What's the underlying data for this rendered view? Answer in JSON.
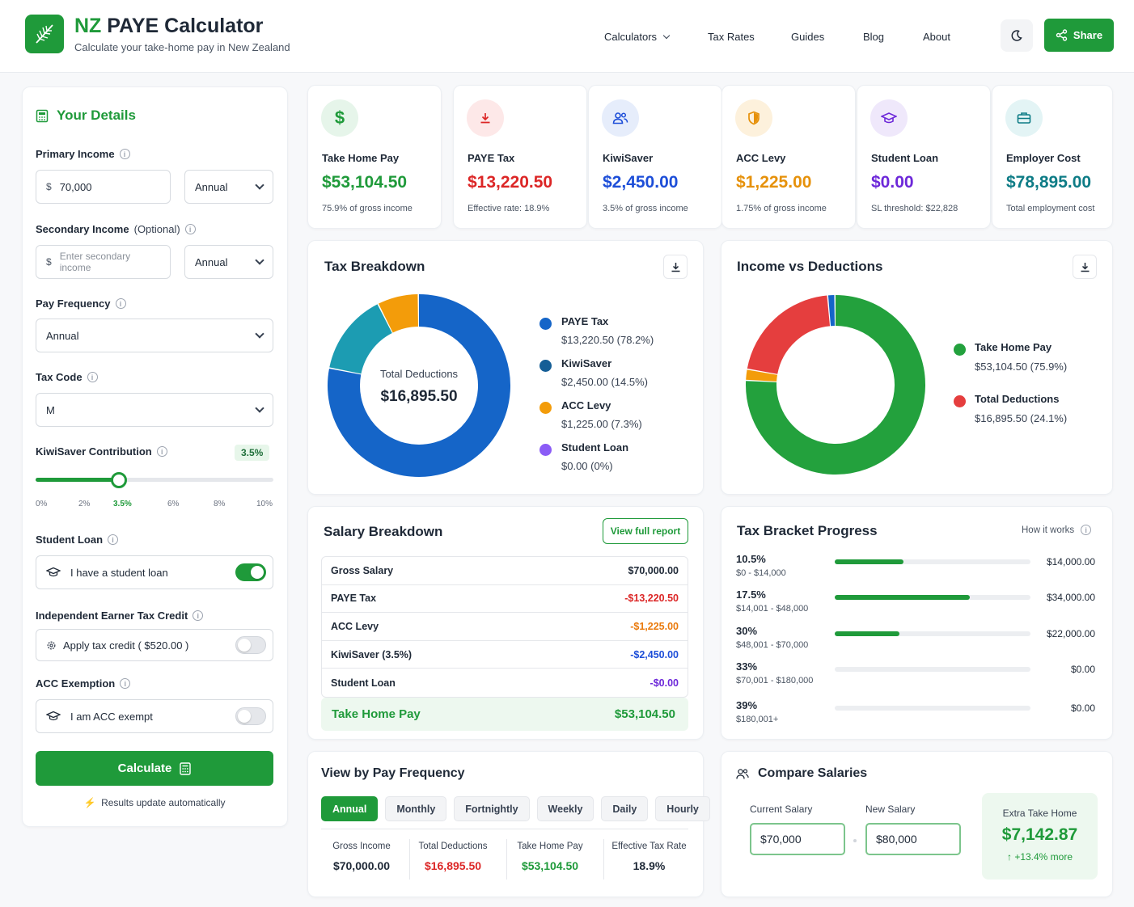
{
  "header": {
    "title_prefix": "NZ",
    "title_rest": "PAYE Calculator",
    "subtitle": "Calculate your take-home pay in New Zealand",
    "nav": [
      "Calculators",
      "Tax Rates",
      "Guides",
      "Blog",
      "About"
    ],
    "share": "Share"
  },
  "sidebar": {
    "title": "Your Details",
    "primary_label": "Primary Income",
    "primary_value": "70,000",
    "primary_period": "Annual",
    "secondary_label": "Secondary Income",
    "secondary_optional": "(Optional)",
    "secondary_placeholder": "Enter secondary income",
    "secondary_period": "Annual",
    "freq_label": "Pay Frequency",
    "freq_value": "Annual",
    "taxcode_label": "Tax Code",
    "taxcode_value": "M",
    "kiwisaver_label": "KiwiSaver Contribution",
    "kiwisaver_value": "3.5%",
    "kiwisaver_fraction": 0.35,
    "ticks": [
      "0%",
      "2%",
      "3.5%",
      "6%",
      "8%",
      "10%"
    ],
    "student_label": "Student Loan",
    "student_text": "I have a student loan",
    "student_on": true,
    "ietc_label": "Independent Earner Tax Credit",
    "ietc_text": "Apply tax credit ( $520.00 )",
    "ietc_on": false,
    "acc_label": "ACC Exemption",
    "acc_text": "I am ACC exempt",
    "acc_on": false,
    "calculate": "Calculate",
    "auto_note": "Results update automatically"
  },
  "stats": [
    {
      "label": "Take Home Pay",
      "value": "$53,104.50",
      "sub": "75.9% of gross income",
      "color": "#1f9a3a",
      "bg": "#e6f5ea",
      "icon": "dollar-icon"
    },
    {
      "label": "PAYE Tax",
      "value": "$13,220.50",
      "sub": "Effective rate: 18.9%",
      "color": "#dc2626",
      "bg": "#fde8e8",
      "icon": "download-arrow-icon"
    },
    {
      "label": "KiwiSaver",
      "value": "$2,450.00",
      "sub": "3.5% of gross income",
      "color": "#1d4ed8",
      "bg": "#e6edfb",
      "icon": "users-icon"
    },
    {
      "label": "ACC Levy",
      "value": "$1,225.00",
      "sub": "1.75% of gross income",
      "color": "#e6910a",
      "bg": "#fdf1dc",
      "icon": "shield-icon"
    },
    {
      "label": "Student Loan",
      "value": "$0.00",
      "sub": "SL threshold: $22,828",
      "color": "#6d28d9",
      "bg": "#efe8fb",
      "icon": "graduation-cap-icon"
    },
    {
      "label": "Employer Cost",
      "value": "$78,895.00",
      "sub": "Total employment cost",
      "color": "#0e7c86",
      "bg": "#e3f4f5",
      "icon": "briefcase-icon"
    }
  ],
  "tax_breakdown": {
    "title": "Tax Breakdown",
    "center_label": "Total Deductions",
    "center_value": "$16,895.50",
    "items": [
      {
        "name": "PAYE Tax",
        "value": "$13,220.50 (78.2%)",
        "pct": 78.2,
        "color": "#1565c8"
      },
      {
        "name": "KiwiSaver",
        "value": "$2,450.00 (14.5%)",
        "pct": 14.5,
        "color": "#1c9cb2"
      },
      {
        "name": "ACC Levy",
        "value": "$1,225.00 (7.3%)",
        "pct": 7.3,
        "color": "#f39c0a"
      },
      {
        "name": "Student Loan",
        "value": "$0.00 (0%)",
        "pct": 0,
        "color": "#8b5cf6"
      }
    ],
    "legend_colors": [
      "#1565c8",
      "#155e96",
      "#f39c0a",
      "#8b5cf6"
    ]
  },
  "income_vs": {
    "title": "Income vs Deductions",
    "items": [
      {
        "name": "Take Home Pay",
        "value": "$53,104.50 (75.9%)",
        "color": "#23a13d"
      },
      {
        "name": "Total Deductions",
        "value": "$16,895.50 (24.1%)",
        "color": "#e53e3e"
      }
    ],
    "segments": [
      {
        "pct": 75.9,
        "color": "#23a13d"
      },
      {
        "pct": 2.0,
        "color": "#f39c0a"
      },
      {
        "pct": 20.8,
        "color": "#e53e3e"
      },
      {
        "pct": 1.3,
        "color": "#1565c8"
      }
    ]
  },
  "salary": {
    "title": "Salary Breakdown",
    "button": "View full report",
    "rows": [
      {
        "label": "Gross Salary",
        "value": "$70,000.00",
        "style": ""
      },
      {
        "label": "PAYE Tax",
        "value": "-$13,220.50",
        "style": "neg"
      },
      {
        "label": "ACC Levy",
        "value": "-$1,225.00",
        "style": "neg orange"
      },
      {
        "label": "KiwiSaver (3.5%)",
        "value": "-$2,450.00",
        "style": "neg blue"
      },
      {
        "label": "Student Loan",
        "value": "-$0.00",
        "style": "neg purple"
      }
    ],
    "total_label": "Take Home Pay",
    "total_value": "$53,104.50"
  },
  "brackets": {
    "title": "Tax Bracket Progress",
    "how": "How it works",
    "rows": [
      {
        "rate": "10.5%",
        "range": "$0 - $14,000",
        "amount": "$14,000.00",
        "fill": 0.35
      },
      {
        "rate": "17.5%",
        "range": "$14,001 - $48,000",
        "amount": "$34,000.00",
        "fill": 0.69
      },
      {
        "rate": "30%",
        "range": "$48,001 - $70,000",
        "amount": "$22,000.00",
        "fill": 0.33
      },
      {
        "rate": "33%",
        "range": "$70,001 - $180,000",
        "amount": "$0.00",
        "fill": 0
      },
      {
        "rate": "39%",
        "range": "$180,001+",
        "amount": "$0.00",
        "fill": 0
      }
    ]
  },
  "frequency": {
    "title": "View by Pay Frequency",
    "tabs": [
      "Annual",
      "Monthly",
      "Fortnightly",
      "Weekly",
      "Daily",
      "Hourly"
    ],
    "cols": [
      {
        "label": "Gross Income",
        "value": "$70,000.00",
        "color": "#1f2937"
      },
      {
        "label": "Total Deductions",
        "value": "$16,895.50",
        "color": "#dc2626"
      },
      {
        "label": "Take Home Pay",
        "value": "$53,104.50",
        "color": "#1f9a3a"
      },
      {
        "label": "Effective Tax Rate",
        "value": "18.9%",
        "color": "#1f2937"
      }
    ]
  },
  "compare": {
    "title": "Compare Salaries",
    "current_label": "Current Salary",
    "current_value": "$70,000",
    "new_label": "New Salary",
    "new_value": "$80,000",
    "extra_label": "Extra Take Home",
    "extra_value": "$7,142.87",
    "extra_change": "+13.4% more"
  }
}
